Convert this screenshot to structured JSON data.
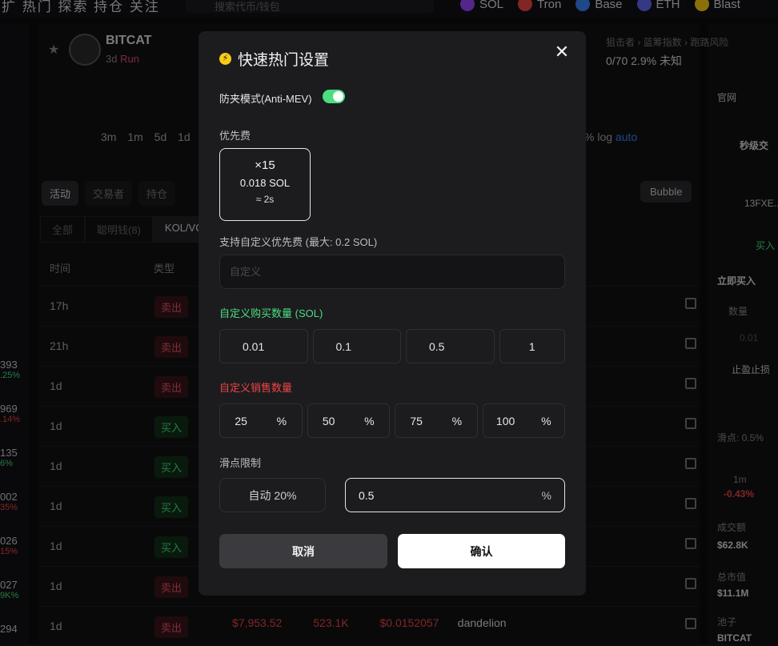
{
  "background": {
    "nav_text": "扩 热门 探索 持仓 关注",
    "search_placeholder": "搜索代币/钱包",
    "chains": [
      {
        "label": "SOL",
        "color": "#9945ff"
      },
      {
        "label": "Tron",
        "color": "#ef4444"
      },
      {
        "label": "Base",
        "color": "#3b82f6"
      },
      {
        "label": "ETH",
        "color": "#6366f1"
      },
      {
        "label": "Blast",
        "color": "#facc15"
      }
    ],
    "token": {
      "name": "BITCAT",
      "symbol": "Bitcat",
      "age": "3d",
      "run": "Run"
    },
    "stats_labels": "狙击者 › 蓝筹指数 › 跑路风险",
    "stats_values": "0/70  2.9%  未知",
    "timeframes": "3m 1m 5d 1d",
    "chart_opts": "% log",
    "chart_auto": "auto",
    "tabs1": [
      "活动",
      "交易者",
      "持仓"
    ],
    "bubble_label": "Bubble",
    "tabs2": [
      "全部",
      "聪明钱(8)",
      "KOL/VC"
    ],
    "table_head_time": "时间",
    "table_head_type": "类型",
    "rows": [
      {
        "time": "17h",
        "type": "卖出",
        "kind": "sell"
      },
      {
        "time": "21h",
        "type": "卖出",
        "kind": "sell"
      },
      {
        "time": "1d",
        "type": "卖出",
        "kind": "sell"
      },
      {
        "time": "1d",
        "type": "买入",
        "kind": "buy"
      },
      {
        "time": "1d",
        "type": "买入",
        "kind": "buy"
      },
      {
        "time": "1d",
        "type": "买入",
        "kind": "buy"
      },
      {
        "time": "1d",
        "type": "买入",
        "kind": "buy"
      },
      {
        "time": "1d",
        "type": "卖出",
        "kind": "sell"
      },
      {
        "time": "1d",
        "type": "卖出",
        "kind": "sell"
      }
    ],
    "left_values": [
      {
        "v": "393",
        "c": ".25%",
        "cls": "green"
      },
      {
        "v": "969",
        "c": ".14%",
        "cls": "red"
      },
      {
        "v": "135",
        "c": "6%",
        "cls": "green"
      },
      {
        "v": "002",
        "c": "35%",
        "cls": "red"
      },
      {
        "v": "026",
        "c": "15%",
        "cls": "red"
      },
      {
        "v": "027",
        "c": "9K%",
        "cls": "green"
      },
      {
        "v": "294",
        "c": "",
        "cls": ""
      }
    ],
    "last_row": {
      "amount": "$7,953.52",
      "qty": "523.1K",
      "price": "$0.0152057",
      "name": "dandelion"
    },
    "right_panel": {
      "official": "官网",
      "title": "秒级交",
      "addr": "13FXE...",
      "buy": "买入",
      "buy_now": "立即买入",
      "qty_label": "数量",
      "qty_val": "0.01",
      "stop": "止盈止损",
      "slip": "滑点: 0.5%",
      "tf": "1m",
      "tf_change": "-0.43%",
      "vol_label": "成交额",
      "vol": "$62.8K",
      "mcap_label": "总市值",
      "mcap": "$11.1M",
      "pool_label": "池子",
      "pool": "BITCAT"
    }
  },
  "modal": {
    "title": "快速热门设置",
    "mev_label": "防夹模式(Anti-MEV)",
    "mev_enabled": true,
    "priority_label": "优先费",
    "priority": {
      "multiplier": "×15",
      "sol": "0.018 SOL",
      "time": "≈ 2s"
    },
    "custom_priority_label": "支持自定义优先费 (最大: 0.2 SOL)",
    "custom_priority_placeholder": "自定义",
    "buy_label": "自定义购买数量 (SOL)",
    "buy_amounts": [
      "0.01",
      "0.1",
      "0.5",
      "1"
    ],
    "sell_label": "自定义销售数量",
    "sell_percents": [
      "25",
      "50",
      "75",
      "100"
    ],
    "percent_sign": "%",
    "slippage_label": "滑点限制",
    "slippage_auto": "自动 20%",
    "slippage_value": "0.5",
    "slippage_unit": "%",
    "cancel_label": "取消",
    "confirm_label": "确认",
    "accent_green": "#4ade80",
    "accent_red": "#ef4444"
  }
}
